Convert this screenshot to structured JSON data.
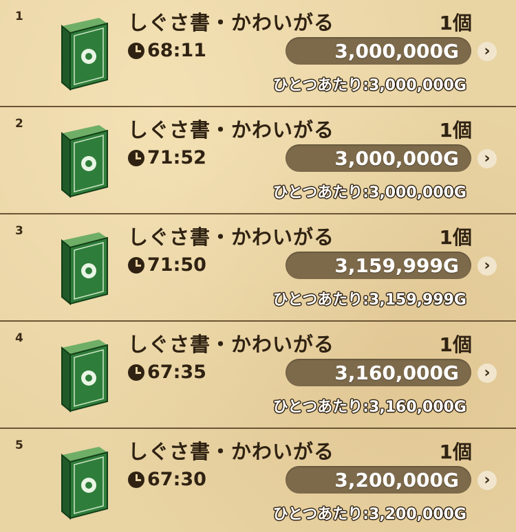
{
  "colors": {
    "background": "#e9d4a4",
    "book_green": "#2f7d3a",
    "price_pill": "#7d6a4b",
    "text_dark": "#2f2212"
  },
  "listings": [
    {
      "rank": "1",
      "item_name": "しぐさ書・かわいがる",
      "quantity": "1個",
      "time_left": "68:11",
      "price": "3,000,000G",
      "unit_price_label": "ひとつあたり",
      "unit_price": "3,000,000G",
      "icon": "book-icon"
    },
    {
      "rank": "2",
      "item_name": "しぐさ書・かわいがる",
      "quantity": "1個",
      "time_left": "71:52",
      "price": "3,000,000G",
      "unit_price_label": "ひとつあたり",
      "unit_price": "3,000,000G",
      "icon": "book-icon"
    },
    {
      "rank": "3",
      "item_name": "しぐさ書・かわいがる",
      "quantity": "1個",
      "time_left": "71:50",
      "price": "3,159,999G",
      "unit_price_label": "ひとつあたり",
      "unit_price": "3,159,999G",
      "icon": "book-icon"
    },
    {
      "rank": "4",
      "item_name": "しぐさ書・かわいがる",
      "quantity": "1個",
      "time_left": "67:35",
      "price": "3,160,000G",
      "unit_price_label": "ひとつあたり",
      "unit_price": "3,160,000G",
      "icon": "book-icon"
    },
    {
      "rank": "5",
      "item_name": "しぐさ書・かわいがる",
      "quantity": "1個",
      "time_left": "67:30",
      "price": "3,200,000G",
      "unit_price_label": "ひとつあたり",
      "unit_price": "3,200,000G",
      "icon": "book-icon"
    }
  ]
}
